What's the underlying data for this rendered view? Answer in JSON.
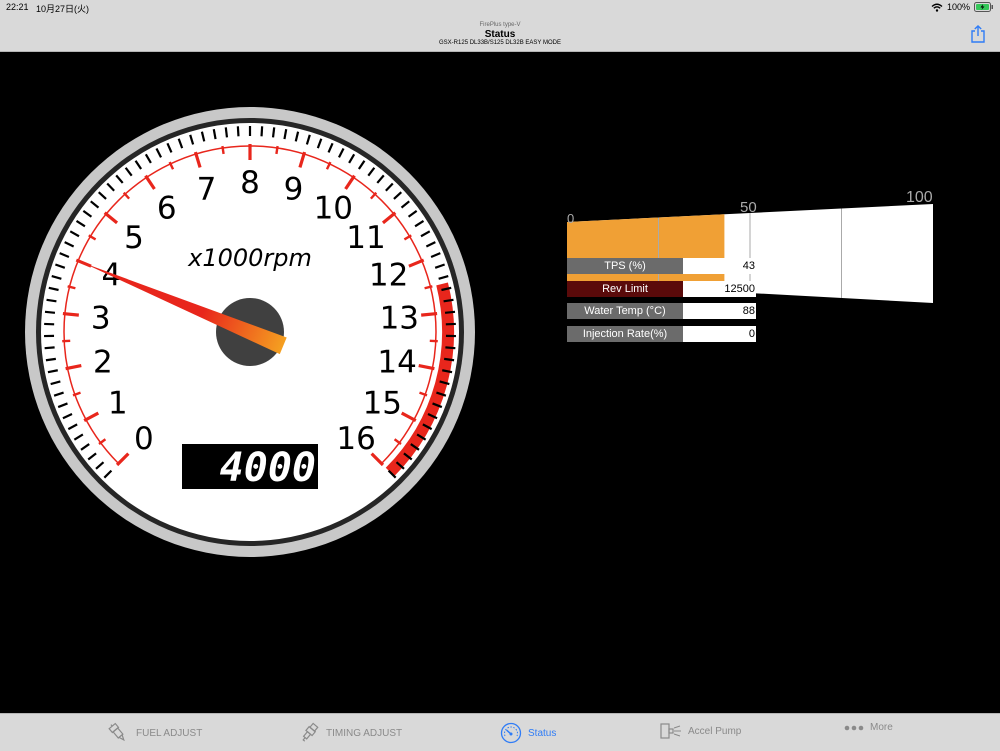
{
  "status_bar": {
    "time": "22:21",
    "date": "10月27日(火)",
    "battery": "100%"
  },
  "header": {
    "app_name": "FirePlus type-V",
    "title": "Status",
    "model": "GSX-R125 DL33B/S125 DL32B EASY MODE"
  },
  "icons": {
    "share": "share-icon",
    "wifi": "wifi-icon",
    "battery": "battery-charging-icon"
  },
  "gauge": {
    "unit_label": "x1000rpm",
    "scale_labels": [
      "0",
      "1",
      "2",
      "3",
      "4",
      "5",
      "6",
      "7",
      "8",
      "9",
      "10",
      "11",
      "12",
      "13",
      "14",
      "15",
      "16"
    ],
    "rpm": 4000,
    "rpm_display": "4000",
    "redline_start": 12.5,
    "needle_color": "#e8261c",
    "red_color": "#e8261c"
  },
  "throttle_bar": {
    "labels": [
      "0",
      "50",
      "100"
    ],
    "value": 43,
    "fill_color": "#f0a035"
  },
  "info": [
    {
      "label": "TPS (%)",
      "value": "43"
    },
    {
      "label": "Rev Limit",
      "value": "12500"
    },
    {
      "label": "Water Temp (°C)",
      "value": "88"
    },
    {
      "label": "Injection Rate(%)",
      "value": "0"
    }
  ],
  "tabs": [
    {
      "label": "FUEL ADJUST",
      "icon": "fuel-injector-icon"
    },
    {
      "label": "TIMING ADJUST",
      "icon": "spark-plug-icon"
    },
    {
      "label": "Status",
      "icon": "speedometer-icon"
    },
    {
      "label": "Accel Pump",
      "icon": "accel-pump-icon"
    },
    {
      "label": "More",
      "icon": "more-dots-icon"
    }
  ],
  "active_tab": "Status"
}
